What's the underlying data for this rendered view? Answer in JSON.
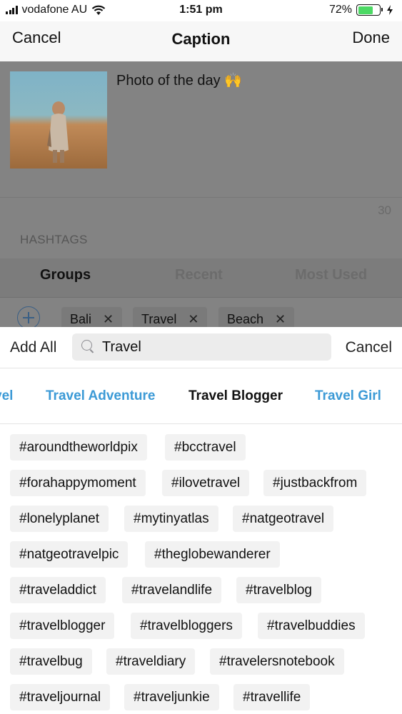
{
  "status_bar": {
    "carrier": "vodafone AU",
    "time": "1:51 pm",
    "battery_percent": "72%",
    "battery_level": 0.72,
    "icons": [
      "signal-icon",
      "wifi-icon",
      "battery-icon",
      "charging-bolt-icon"
    ]
  },
  "nav": {
    "cancel_label": "Cancel",
    "title": "Caption",
    "done_label": "Done"
  },
  "caption": {
    "text": "Photo of the day 🙌",
    "char_count": "30"
  },
  "hashtags": {
    "section_label": "HASHTAGS",
    "tabs": [
      {
        "label": "Groups",
        "active": true
      },
      {
        "label": "Recent",
        "active": false
      },
      {
        "label": "Most Used",
        "active": false
      }
    ],
    "selected_groups": [
      {
        "label": "Bali"
      },
      {
        "label": "Travel"
      },
      {
        "label": "Beach"
      }
    ]
  },
  "search": {
    "add_all_label": "Add All",
    "query": "Travel",
    "cancel_label": "Cancel"
  },
  "group_results": [
    {
      "label": "vel",
      "active": false
    },
    {
      "label": "Travel Adventure",
      "active": false
    },
    {
      "label": "Travel Blogger",
      "active": true
    },
    {
      "label": "Travel Girl",
      "active": false
    }
  ],
  "tags": [
    "#aroundtheworldpix",
    "#bcctravel",
    "#forahappymoment",
    "#ilovetravel",
    "#justbackfrom",
    "#lonelyplanet",
    "#mytinyatlas",
    "#natgeotravel",
    "#natgeotravelpic",
    "#theglobewanderer",
    "#traveladdict",
    "#travelandlife",
    "#travelblog",
    "#travelblogger",
    "#travelbloggers",
    "#travelbuddies",
    "#travelbug",
    "#traveldiary",
    "#travelersnotebook",
    "#traveljournal",
    "#traveljunkie",
    "#travellife"
  ],
  "colors": {
    "accent_blue": "#3c9ad6",
    "battery_green": "#4cd964",
    "pill_bg": "#f2f2f2",
    "dim_overlay": "#838383"
  }
}
